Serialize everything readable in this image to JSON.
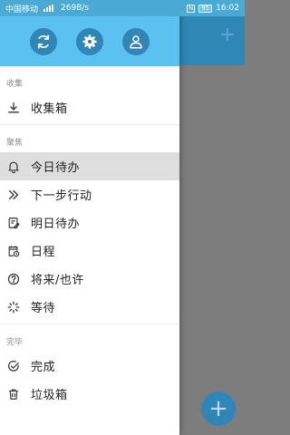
{
  "status_bar": {
    "carrier": "中国移动",
    "network_speed": "269B/s",
    "nfc": "N",
    "battery": "95",
    "time": "16:02"
  },
  "header": {
    "buttons": [
      {
        "icon": "sync-icon"
      },
      {
        "icon": "gear-icon"
      },
      {
        "icon": "user-icon"
      }
    ]
  },
  "menu": {
    "sections": [
      {
        "label": "收集",
        "items": [
          {
            "label": "收集箱",
            "icon": "download-icon"
          }
        ]
      },
      {
        "label": "聚焦",
        "items": [
          {
            "label": "今日待办",
            "icon": "bell-icon",
            "active": true
          },
          {
            "label": "下一步行动",
            "icon": "double-chevron-right-icon"
          },
          {
            "label": "明日待办",
            "icon": "calendar-edit-icon"
          },
          {
            "label": "日程",
            "icon": "schedule-icon"
          },
          {
            "label": "将来/也许",
            "icon": "question-icon"
          },
          {
            "label": "等待",
            "icon": "loading-icon"
          }
        ]
      },
      {
        "label": "完毕",
        "items": [
          {
            "label": "完成",
            "icon": "check-circle-icon"
          },
          {
            "label": "垃圾箱",
            "icon": "trash-icon"
          }
        ]
      }
    ]
  },
  "background": {
    "add_icon": "+",
    "fab_icon": "+"
  },
  "colors": {
    "header": "#5bc1f0",
    "header_button": "#2f86b7",
    "active_item": "#dedede",
    "overlay": "#7d7d7d"
  }
}
